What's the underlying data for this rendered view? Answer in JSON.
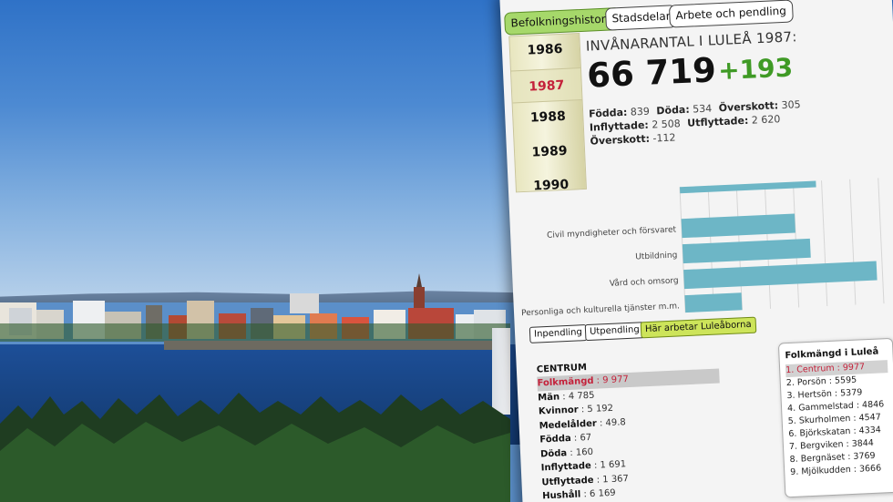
{
  "tabs": [
    {
      "label": "Befolkningshistorik",
      "active": true
    },
    {
      "label": "Stadsdelar",
      "active": false
    },
    {
      "label": "Arbete och pendling",
      "active": false
    }
  ],
  "years": [
    {
      "label": "1986",
      "current": false
    },
    {
      "label": "1987",
      "current": true
    },
    {
      "label": "1988",
      "current": false
    },
    {
      "label": "1989",
      "current": false
    },
    {
      "label": "1990",
      "current": false
    }
  ],
  "population": {
    "title": "INVÅNARANTAL I LULEÅ 1987:",
    "number": "66 719",
    "change": "+193"
  },
  "stats": {
    "fodda_label": "Födda",
    "fodda": "839",
    "doda_label": "Döda",
    "doda": "534",
    "overskott1_label": "Överskott",
    "overskott1": "305",
    "inflyttade_label": "Inflyttade",
    "inflyttade": "2 508",
    "utflyttade_label": "Utflyttade",
    "utflyttade": "2 620",
    "overskott2_label": "Överskott",
    "overskott2": "-112"
  },
  "chart_data": {
    "type": "bar",
    "orientation": "horizontal",
    "categories": [
      "",
      "Civil myndigheter och försvaret",
      "Utbildning",
      "Vård och omsorg",
      "Personliga och kulturella tjänster m.m."
    ],
    "values": [
      4800,
      4000,
      4500,
      6800,
      2000
    ],
    "xlim": [
      0,
      7000
    ],
    "xticks": [
      "0",
      "1 000",
      "2 000",
      "3 000",
      "4 000",
      "5 000",
      "6 000",
      "7 000"
    ],
    "bar_color": "#6db6c6",
    "grid": true
  },
  "subtabs": [
    {
      "label": "Inpendling",
      "active": false
    },
    {
      "label": "Utpendling",
      "active": false
    },
    {
      "label": "Här arbetar Luleåborna",
      "active": true
    }
  ],
  "district": {
    "name": "CENTRUM",
    "rows": [
      {
        "k": "Folkmängd",
        "v": "9 977",
        "hl": true
      },
      {
        "k": "Män",
        "v": "4 785",
        "hl": false
      },
      {
        "k": "Kvinnor",
        "v": "5 192",
        "hl": false
      },
      {
        "k": "Medelålder",
        "v": "49.8",
        "hl": false
      },
      {
        "k": "Födda",
        "v": "67",
        "hl": false
      },
      {
        "k": "Döda",
        "v": "160",
        "hl": false
      },
      {
        "k": "Inflyttade",
        "v": "1 691",
        "hl": false
      },
      {
        "k": "Utflyttade",
        "v": "1 367",
        "hl": false
      },
      {
        "k": "Hushåll",
        "v": "6 169",
        "hl": false
      }
    ]
  },
  "toplist": {
    "title": "Folkmängd i Luleå",
    "items": [
      {
        "label": "1. Centrum : 9977",
        "hl": true
      },
      {
        "label": "2. Porsön : 5595",
        "hl": false
      },
      {
        "label": "3. Hertsön : 5379",
        "hl": false
      },
      {
        "label": "4. Gammelstad : 4846",
        "hl": false
      },
      {
        "label": "5. Skurholmen : 4547",
        "hl": false
      },
      {
        "label": "6. Björkskatan : 4334",
        "hl": false
      },
      {
        "label": "7. Bergviken : 3844",
        "hl": false
      },
      {
        "label": "8. Bergnäset : 3769",
        "hl": false
      },
      {
        "label": "9. Mjölkudden : 3666",
        "hl": false
      }
    ]
  }
}
